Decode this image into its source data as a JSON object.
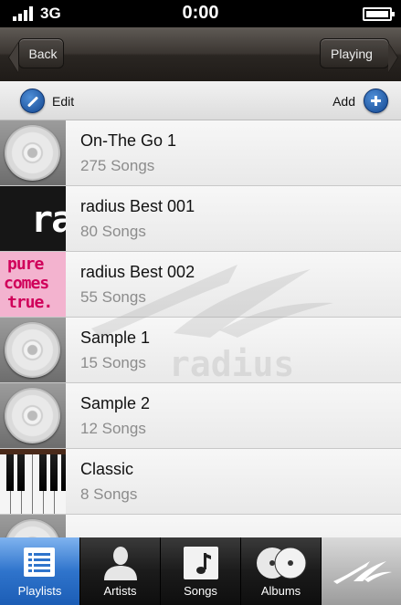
{
  "status_bar": {
    "carrier": "3G",
    "time": "0:00"
  },
  "nav": {
    "back_label": "Back",
    "playing_label": "Playing"
  },
  "toolbar": {
    "edit_label": "Edit",
    "add_label": "Add"
  },
  "playlists": [
    {
      "title": "On-The Go 1",
      "subtitle": "275 Songs",
      "art": "cd"
    },
    {
      "title": "radius Best 001",
      "subtitle": "80 Songs",
      "art": "ra"
    },
    {
      "title": "radius Best 002",
      "subtitle": "55 Songs",
      "art": "pure-comes-true"
    },
    {
      "title": "Sample 1",
      "subtitle": "15 Songs",
      "art": "cd"
    },
    {
      "title": "Sample 2",
      "subtitle": "12 Songs",
      "art": "cd"
    },
    {
      "title": "Classic",
      "subtitle": "8 Songs",
      "art": "piano"
    },
    {
      "title": "",
      "subtitle": "",
      "art": "cd"
    }
  ],
  "album_art_text": {
    "ra": "ra",
    "pure": [
      "pure",
      "comes",
      "true."
    ]
  },
  "watermark_text": "radius",
  "tabs": [
    {
      "label": "Playlists",
      "icon": "playlist-icon",
      "active": true
    },
    {
      "label": "Artists",
      "icon": "person-icon",
      "active": false
    },
    {
      "label": "Songs",
      "icon": "music-note-icon",
      "active": false
    },
    {
      "label": "Albums",
      "icon": "albums-icon",
      "active": false
    },
    {
      "label": "",
      "icon": "radius-logo-icon",
      "active": false
    }
  ],
  "colors": {
    "active_tab": "#2f74cc",
    "accent_blue": "#13468f",
    "pink_art": "#f3b3cf"
  }
}
